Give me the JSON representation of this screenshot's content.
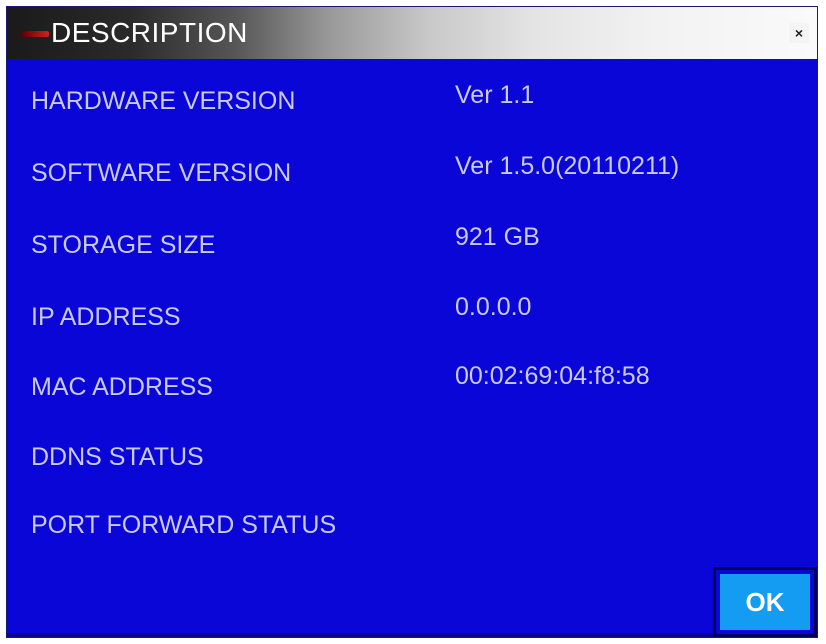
{
  "window": {
    "title": "DESCRIPTION",
    "close_label": "×"
  },
  "rows": [
    {
      "label": "HARDWARE VERSION",
      "value": "Ver 1.1"
    },
    {
      "label": "SOFTWARE VERSION",
      "value": "Ver 1.5.0(20110211)"
    },
    {
      "label": "STORAGE SIZE",
      "value": "921 GB"
    },
    {
      "label": "IP ADDRESS",
      "value": "0.0.0.0"
    },
    {
      "label": "MAC ADDRESS",
      "value": "00:02:69:04:f8:58"
    },
    {
      "label": "DDNS STATUS",
      "value": ""
    },
    {
      "label": "PORT FORWARD STATUS",
      "value": ""
    }
  ],
  "buttons": {
    "ok_label": "OK"
  },
  "colors": {
    "background": "#0a06d8",
    "text": "#c9c9f2",
    "ok_button": "#149cf2"
  }
}
